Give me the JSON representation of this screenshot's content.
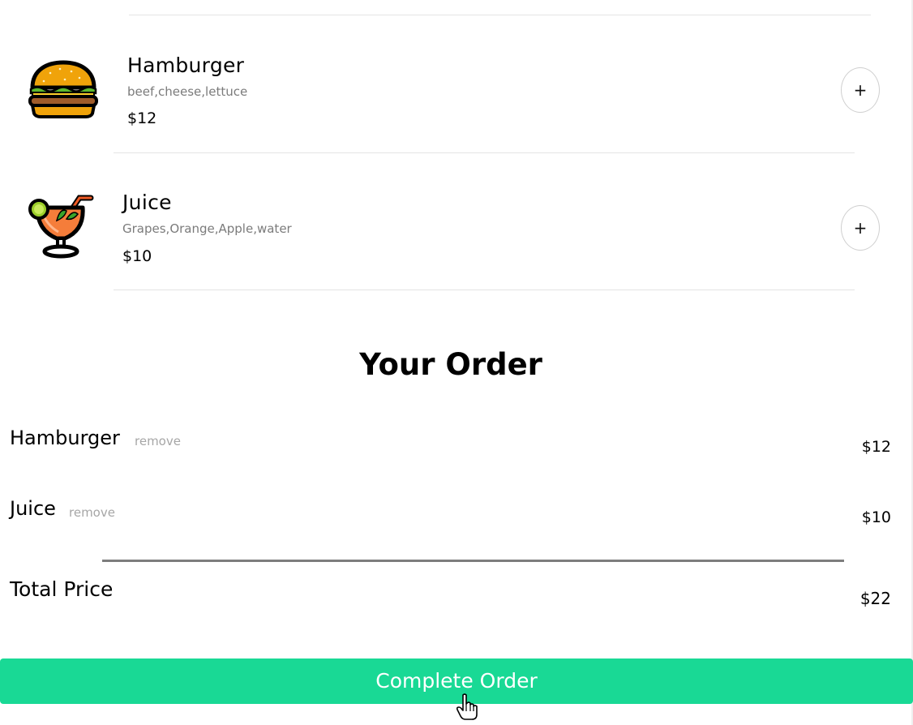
{
  "menu": {
    "items": [
      {
        "name": "Hamburger",
        "ingredients": "beef,cheese,lettuce",
        "price": "$12",
        "icon": "hamburger-emoji-icon",
        "add_label": "+"
      },
      {
        "name": "Juice",
        "ingredients": "Grapes,Orange,Apple,water",
        "price": "$10",
        "icon": "tropical-drink-emoji-icon",
        "add_label": "+"
      }
    ]
  },
  "order": {
    "title": "Your Order",
    "remove_label": "remove",
    "items": [
      {
        "name": "Hamburger",
        "price": "$12"
      },
      {
        "name": "Juice",
        "price": "$10"
      }
    ],
    "total_label": "Total Price",
    "total_price": "$22"
  },
  "actions": {
    "complete_label": "Complete Order"
  },
  "colors": {
    "accent": "#19d995",
    "muted_text": "#7b7b7b",
    "remove_text": "#a6a6a6",
    "divider": "#e4e4e4"
  }
}
